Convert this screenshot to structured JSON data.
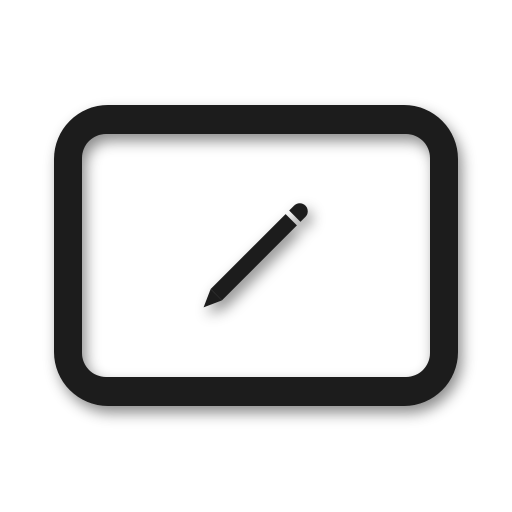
{
  "icon": {
    "name": "edit-frame-icon",
    "glyph_name": "pencil-icon",
    "frame_name": "rounded-rectangle-frame",
    "colors": {
      "background": "#ffffff",
      "ink": "#1b1b1b",
      "shadow": "#000000"
    }
  }
}
